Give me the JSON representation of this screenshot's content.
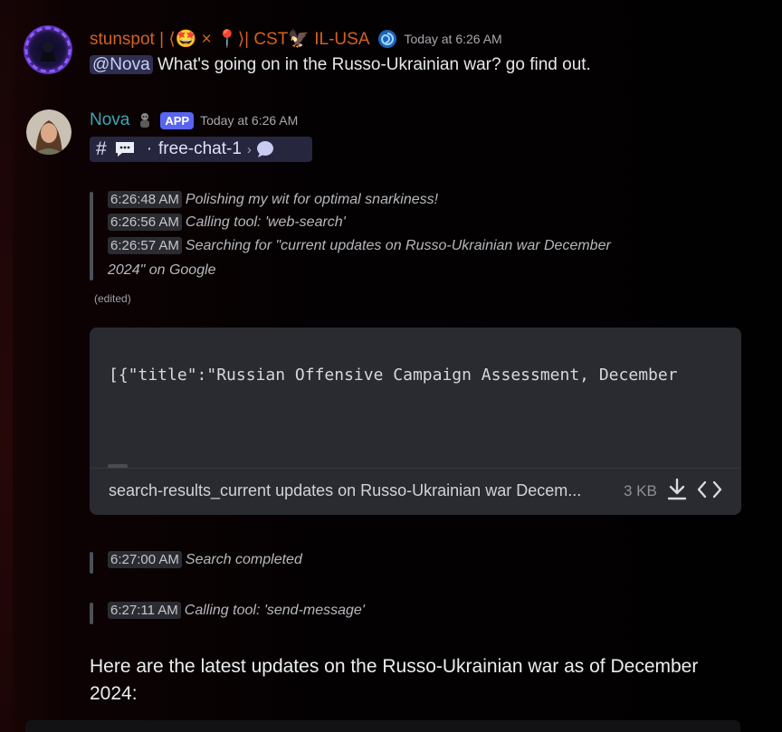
{
  "messages": [
    {
      "author": "stunspot | ⟨🤩 × 📍⟩| CST🦅 IL-USA",
      "timestamp": "Today at 6:26 AM",
      "mention": "@Nova",
      "text": "What's going on in the Russo-Ukrainian war? go find out."
    },
    {
      "author": "Nova",
      "badge": "APP",
      "timestamp": "Today at 6:26 AM",
      "channel": {
        "hash": "#",
        "separator": "·",
        "name": "free-chat-1",
        "chevron": "›"
      },
      "log1": [
        {
          "time": "6:26:48 AM",
          "text": "Polishing my wit for optimal snarkiness!"
        },
        {
          "time": "6:26:56 AM",
          "text": "Calling tool: 'web-search'"
        },
        {
          "time": "6:26:57 AM",
          "text": "Searching for \"current updates on Russo-Ukrainian war December"
        },
        {
          "time": "",
          "text": "2024\" on Google"
        }
      ],
      "edited": "(edited)",
      "attachment": {
        "preview": "[{\"title\":\"Russian Offensive Campaign Assessment, December",
        "filename": "search-results_current updates on Russo-Ukrainian war Decem...",
        "size": "3 KB"
      },
      "log2": {
        "time": "6:27:00 AM",
        "text": "Search completed"
      },
      "log3": {
        "time": "6:27:11 AM",
        "text": "Calling tool: 'send-message'"
      },
      "body": "Here are the latest updates on the Russo-Ukrainian war as of December 2024:"
    }
  ],
  "icons": {
    "stunspot_status": "swirl-badge-icon",
    "nova_emoji": "figure-icon",
    "channel_chat": "speech-bubble-icon",
    "thread": "thread-bubble-icon",
    "download": "download-icon",
    "view_code": "code-brackets-icon"
  },
  "colors": {
    "stunspot_name": "#d4621f",
    "nova_name": "#3aa7b5",
    "app_badge": "#5865f2",
    "mention_bg": "#2d2f4d"
  }
}
